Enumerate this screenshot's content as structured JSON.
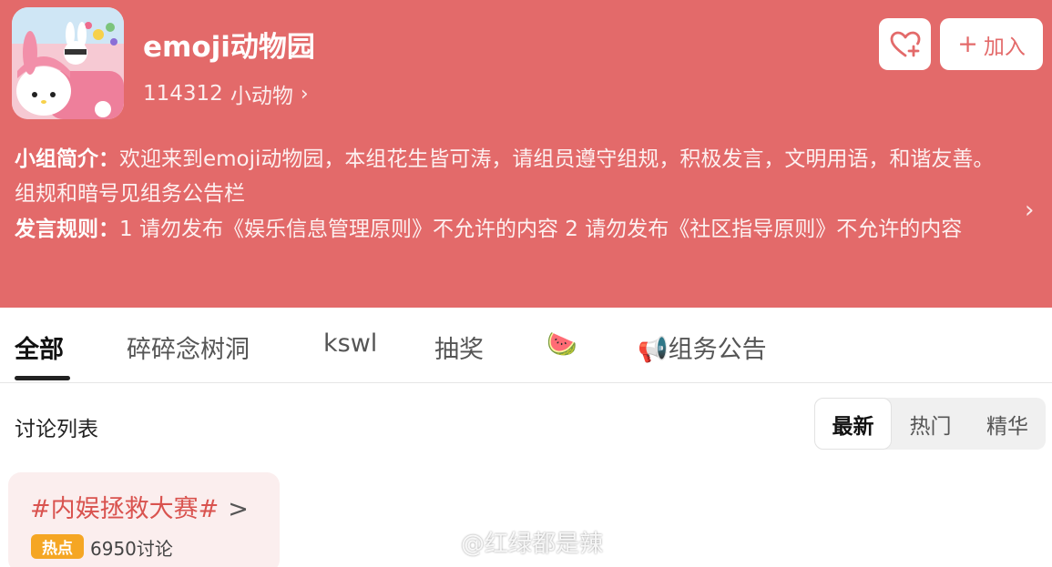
{
  "group": {
    "name": "emoji动物园",
    "member_count": "114312",
    "member_unit": "小动物",
    "intro_label": "小组简介：",
    "intro_text": "欢迎来到emoji动物园，本组花生皆可涛，请组员遵守组规，积极发言，文明用语，和谐友善。 组规和暗号见组务公告栏",
    "rules_label": "发言规则：",
    "rules_text": "1 请勿发布《娱乐信息管理原则》不允许的内容 2 请勿发布《社区指导原则》不允许的内容"
  },
  "actions": {
    "join_plus": "+",
    "join_label": "加入"
  },
  "tabs": [
    "全部",
    "碎碎念树洞",
    "kswl",
    "抽奖",
    "🍉",
    "📢组务公告"
  ],
  "discussion": {
    "title": "讨论列表",
    "sort_options": [
      "最新",
      "热门",
      "精华"
    ]
  },
  "topic": {
    "title": "#内娱拯救大赛#",
    "chevron": ">",
    "badge": "热点",
    "count": "6950讨论"
  },
  "watermark": "@红绿都是辣",
  "colors": {
    "header_bg": "#e36a6a",
    "hot_badge": "#f5a623",
    "topic_title": "#d9534f"
  }
}
